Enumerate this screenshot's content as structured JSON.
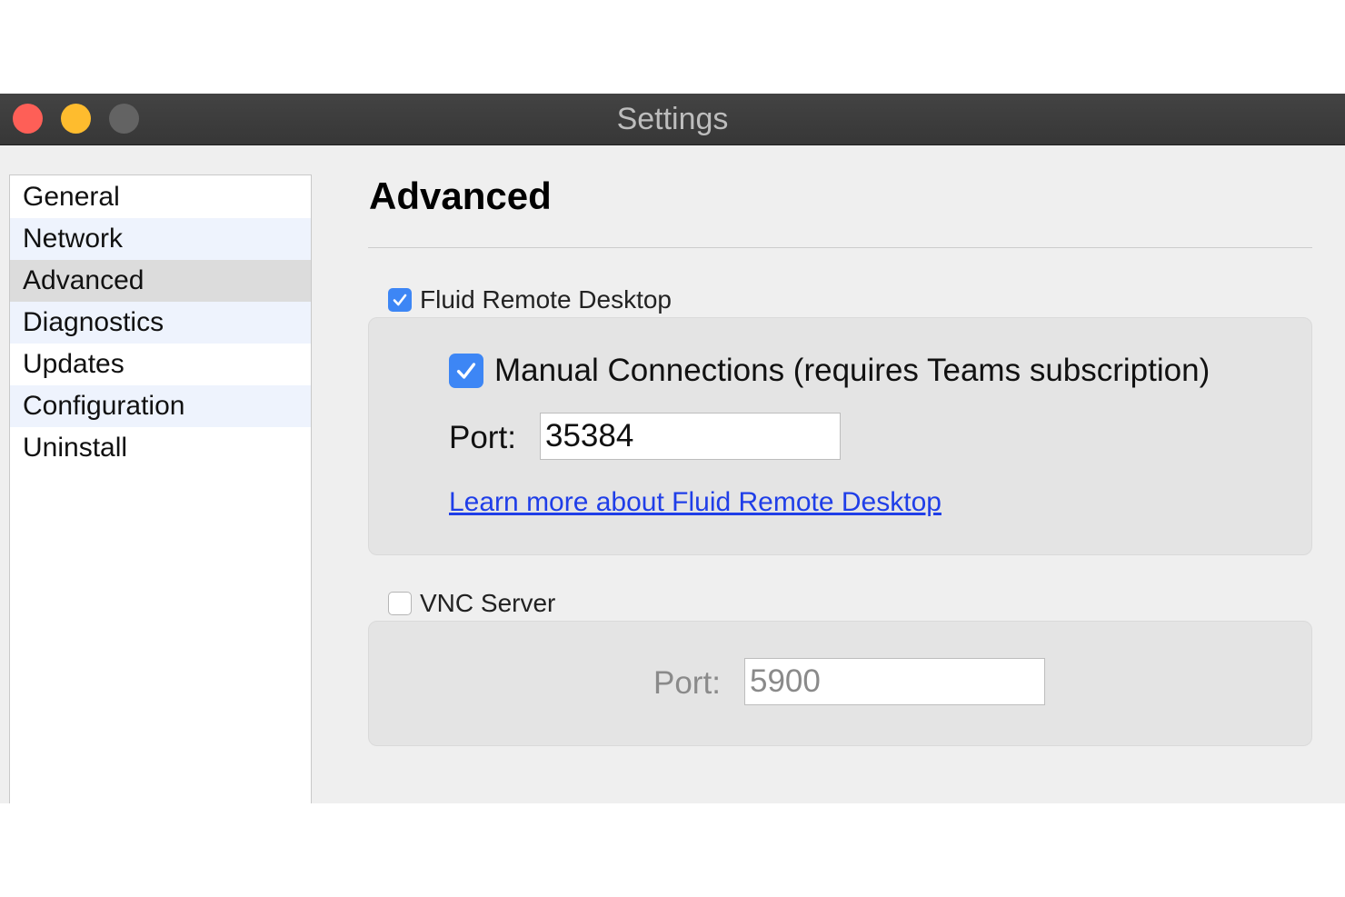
{
  "window": {
    "title": "Settings"
  },
  "sidebar": {
    "items": [
      {
        "label": "General"
      },
      {
        "label": "Network"
      },
      {
        "label": "Advanced"
      },
      {
        "label": "Diagnostics"
      },
      {
        "label": "Updates"
      },
      {
        "label": "Configuration"
      },
      {
        "label": "Uninstall"
      }
    ],
    "selected": "Advanced"
  },
  "main": {
    "title": "Advanced",
    "fluid": {
      "label": "Fluid Remote Desktop",
      "checked": true,
      "manual_label": "Manual Connections (requires Teams subscription)",
      "manual_checked": true,
      "port_label": "Port:",
      "port_value": "35384",
      "link_text": "Learn more about Fluid Remote Desktop"
    },
    "vnc": {
      "label": "VNC Server",
      "checked": false,
      "port_label": "Port:",
      "port_value": "5900"
    }
  },
  "colors": {
    "accent": "#3d86f5",
    "link": "#1f3ee8",
    "close": "#fe5f57",
    "minimize": "#febc2e",
    "zoom_disabled": "#636363"
  }
}
